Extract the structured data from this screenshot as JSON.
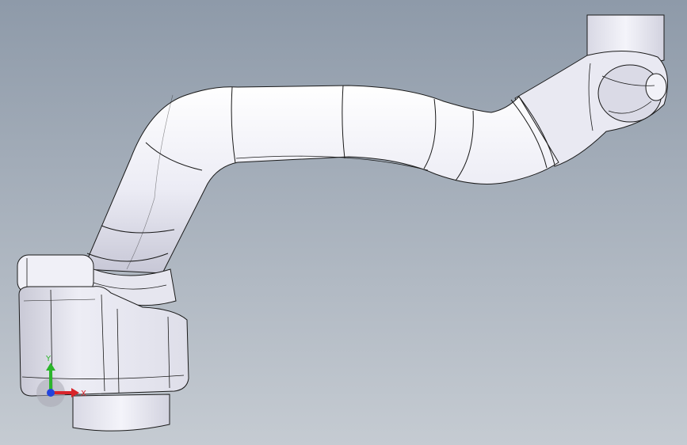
{
  "viewport": {
    "background_top": "#8e9aa9",
    "background_bottom": "#c5cbd2"
  },
  "model": {
    "surface_color": "#eeeef6",
    "shade_color": "#c9c9d6",
    "edge_color": "#1a1a1a"
  },
  "triad": {
    "x_label": "X",
    "y_label": "Y",
    "x_color": "#d8242a",
    "y_color": "#2bb52b",
    "z_color": "#2244dd"
  }
}
